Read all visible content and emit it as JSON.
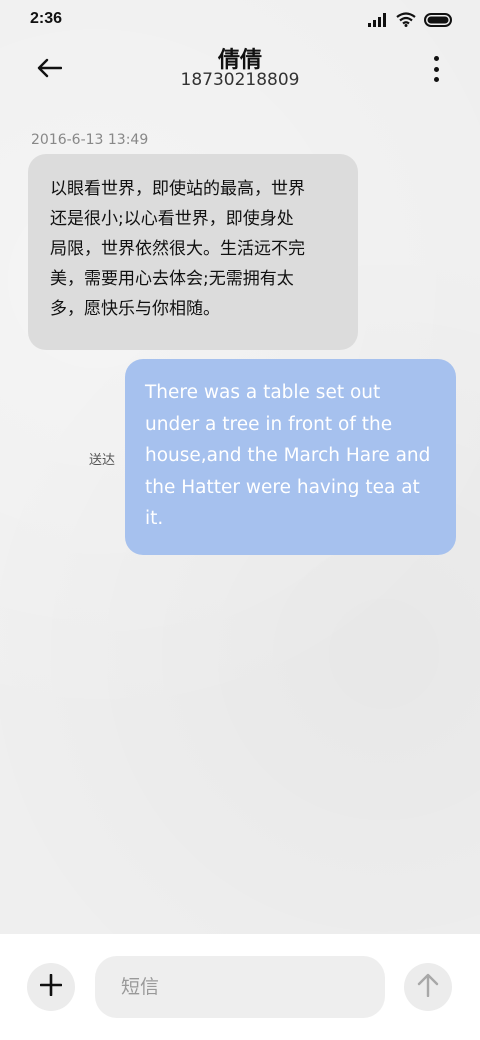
{
  "status_bar": {
    "time": "2:36",
    "icons": [
      "signal-icon",
      "wifi-icon",
      "battery-icon"
    ]
  },
  "header": {
    "contact_name": "倩倩",
    "phone_number": "18730218809",
    "back_icon": "back-arrow-icon",
    "more_icon": "more-vertical-icon"
  },
  "messages": [
    {
      "direction": "incoming",
      "timestamp": "2016-6-13 13:49",
      "lines": [
        "以眼看世界，即使站的最高，世界",
        "还是很小;以心看世界，即使身处",
        "局限，世界依然很大。生活远不完",
        "美，需要用心去体会;无需拥有太",
        "多，愿快乐与你相随。"
      ]
    },
    {
      "direction": "outgoing",
      "status": "送达",
      "lines": [
        "There was a table set out",
        "under a tree in front of the",
        "house,and the March Hare and",
        "the Hatter were having tea at",
        "it."
      ]
    }
  ],
  "composer": {
    "add_icon": "plus-icon",
    "input_placeholder": "短信",
    "input_value": "",
    "send_icon": "send-arrow-up-icon"
  },
  "colors": {
    "incoming_bubble": "#dcdcdc",
    "outgoing_bubble": "#a6c1ee",
    "outgoing_text": "#ffffff",
    "background": "#efefef"
  }
}
